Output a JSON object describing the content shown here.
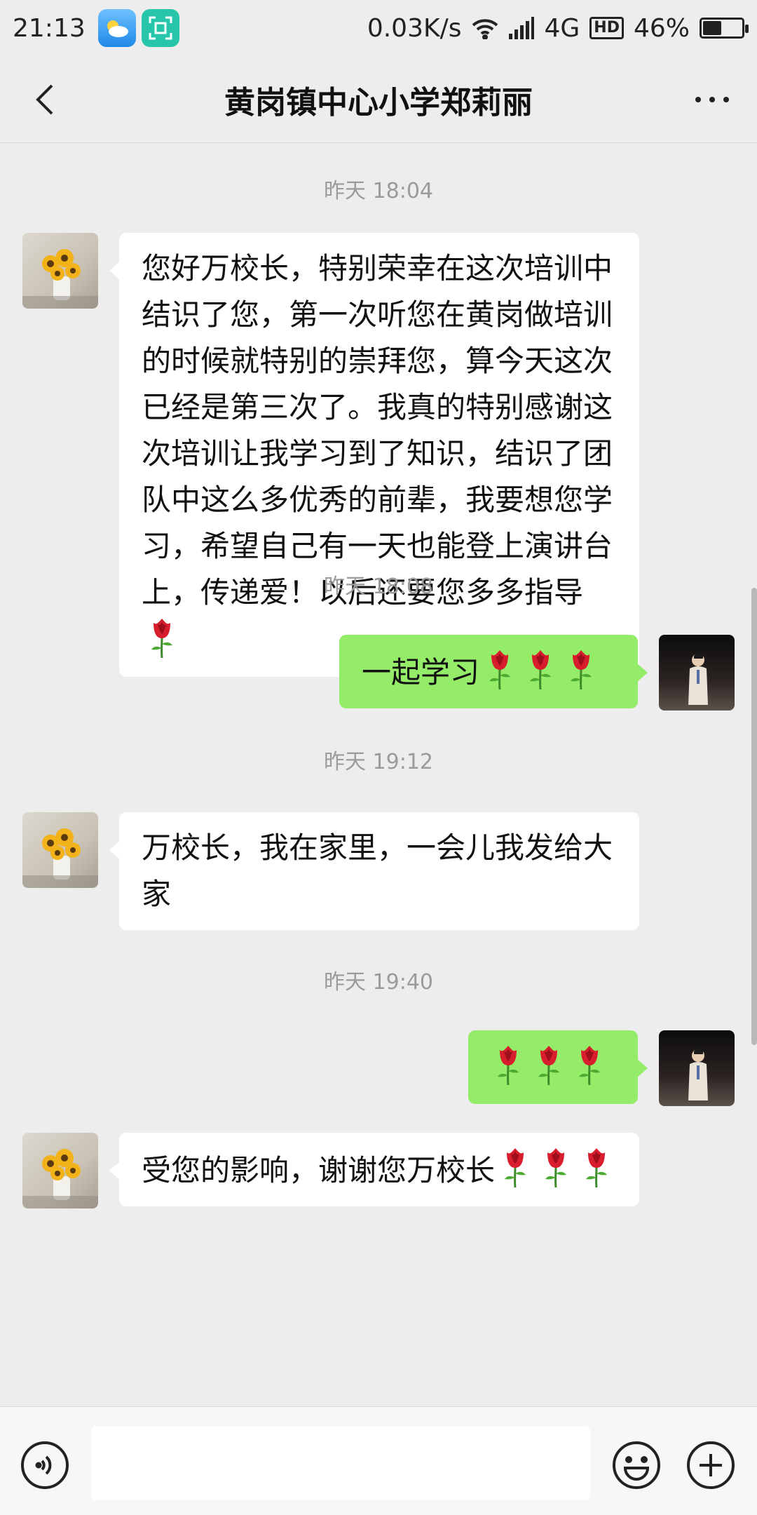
{
  "status_bar": {
    "time": "21:13",
    "net_speed": "0.03K/s",
    "network": "4G",
    "hd": "HD",
    "battery": "46%",
    "battery_level": 0.46,
    "icons": [
      "weather-app-icon",
      "scan-app-icon",
      "wifi-icon",
      "signal-icon",
      "battery-icon"
    ]
  },
  "header": {
    "title": "黄岗镇中心小学郑莉丽"
  },
  "messages": [
    {
      "time": "昨天 18:04",
      "side": "left",
      "text": "您好万校长，特别荣幸在这次培训中结识了您，第一次听您在黄岗做培训的时候就特别的崇拜您，算今天这次已经是第三次了。我真的特别感谢这次培训让我学习到了知识，结识了团队中这么多优秀的前辈，我要想您学习，希望自己有一天也能登上演讲台上，传递爱！以后还要您多多指导",
      "emoji": [
        "rose",
        ""
      ]
    },
    {
      "time": "昨天 18:08",
      "side": "right",
      "text": "一起学习",
      "emoji": [
        "rose",
        "rose",
        "rose"
      ]
    },
    {
      "time": "昨天 19:12",
      "side": "left",
      "text": "万校长，我在家里，一会儿我发给大家"
    },
    {
      "time": "昨天 19:40",
      "side": "right",
      "text": "",
      "emoji": [
        "rose",
        "rose",
        "rose"
      ]
    },
    {
      "side": "left",
      "text": "受您的影响，谢谢您万校长",
      "emoji": [
        "rose",
        "rose",
        "rose"
      ]
    }
  ],
  "colors": {
    "background": "#ededed",
    "sent_bubble": "#95ec69",
    "received_bubble": "#ffffff"
  }
}
